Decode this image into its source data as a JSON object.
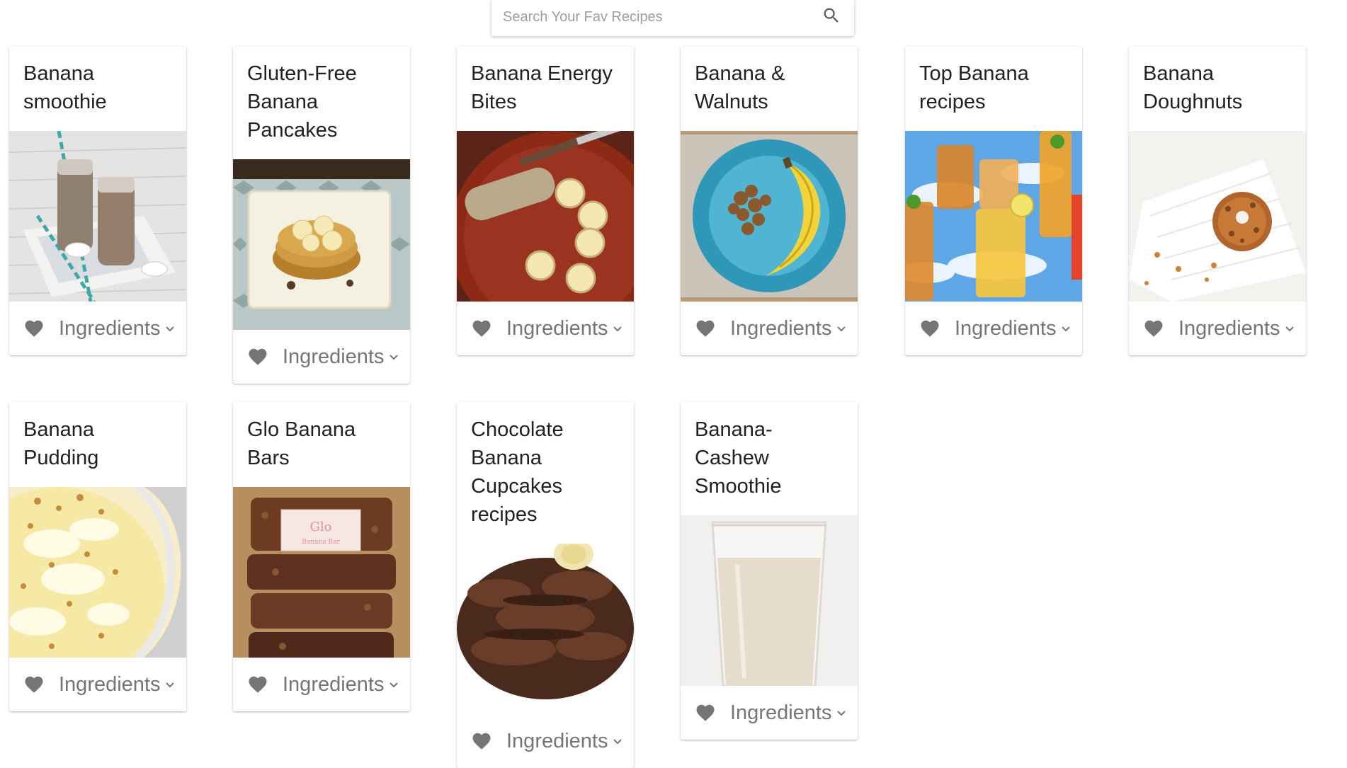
{
  "search": {
    "placeholder": "Search Your Fav Recipes",
    "icon": "search-icon"
  },
  "recipes": [
    {
      "title": "Banana smoothie",
      "action_label": "Ingredients",
      "image": "banana-smoothie-photo"
    },
    {
      "title": "Gluten-Free Banana Pancakes",
      "action_label": "Ingredients",
      "image": "banana-pancakes-photo"
    },
    {
      "title": "Banana Energy Bites",
      "action_label": "Ingredients",
      "image": "banana-energy-bites-photo"
    },
    {
      "title": "Banana & Walnuts",
      "action_label": "Ingredients",
      "image": "banana-walnuts-photo"
    },
    {
      "title": "Top Banana recipes",
      "action_label": "Ingredients",
      "image": "iced-drinks-photo"
    },
    {
      "title": "Banana Doughnuts",
      "action_label": "Ingredients",
      "image": "banana-doughnut-photo"
    },
    {
      "title": "Banana Pudding",
      "action_label": "Ingredients",
      "image": "banana-pudding-photo"
    },
    {
      "title": "Glo Banana Bars",
      "action_label": "Ingredients",
      "image": "banana-bars-photo",
      "image_label": "Glo",
      "image_sublabel": "Banana Bar"
    },
    {
      "title": "Chocolate Banana Cupcakes recipes",
      "action_label": "Ingredients",
      "image": "chocolate-cupcake-photo"
    },
    {
      "title": "Banana-Cashew Smoothie",
      "action_label": "Ingredients",
      "image": "cashew-smoothie-photo"
    }
  ],
  "colors": {
    "icon_gray": "#757575",
    "title_text": "#212121",
    "placeholder": "#9e9e9e"
  }
}
